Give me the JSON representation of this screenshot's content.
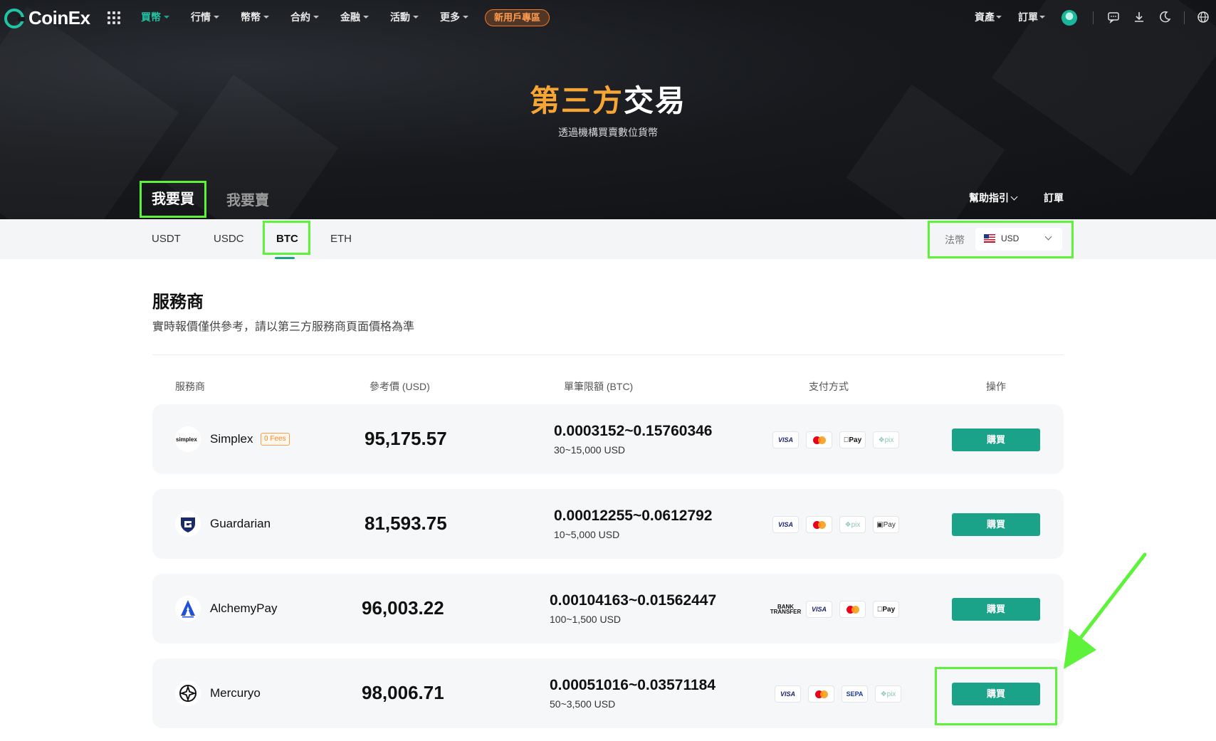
{
  "brand": {
    "name": "CoinEx",
    "accent": "#20c3a4",
    "buy_color": "#1ba389",
    "highlight": "#5ef23a"
  },
  "nav": {
    "menu": [
      "買幣",
      "行情",
      "幣幣",
      "合約",
      "金融",
      "活動",
      "更多"
    ],
    "new_user": "新用戶專區",
    "right": {
      "assets": "資產",
      "orders": "訂單"
    },
    "icons": [
      "grid-menu-icon",
      "avatar",
      "chat-icon",
      "download-icon",
      "moon-icon",
      "globe-icon"
    ]
  },
  "hero": {
    "title_a": "第三方",
    "title_b": "交易",
    "subtitle": "透過機構買賣數位貨幣"
  },
  "tabs": {
    "buy": "我要買",
    "sell": "我要賣",
    "help": "幫助指引",
    "orders": "訂單"
  },
  "coins": [
    "USDT",
    "USDC",
    "BTC",
    "ETH"
  ],
  "selected_coin": "BTC",
  "fiat": {
    "label": "法幣",
    "value": "USD"
  },
  "section": {
    "title": "服務商",
    "subtitle": "實時報價僅供參考，請以第三方服務商頁面價格為準"
  },
  "table": {
    "headers": {
      "provider": "服務商",
      "price": "參考價 (USD)",
      "limit": "單筆限額 (BTC)",
      "payment": "支付方式",
      "action": "操作"
    },
    "rows": [
      {
        "name": "Simplex",
        "badge": "0 Fees",
        "price": "95,175.57",
        "limit": "0.0003152~0.15760346",
        "limit_usd": "30~15,000 USD",
        "payments": [
          "VISA",
          "mastercard",
          "Pay",
          "pix"
        ],
        "action": "購買"
      },
      {
        "name": "Guardarian",
        "price": "81,593.75",
        "limit": "0.00012255~0.0612792",
        "limit_usd": "10~5,000 USD",
        "payments": [
          "VISA",
          "mastercard",
          "pix",
          "Pay"
        ],
        "action": "購買"
      },
      {
        "name": "AlchemyPay",
        "price": "96,003.22",
        "limit": "0.00104163~0.01562447",
        "limit_usd": "100~1,500 USD",
        "payments": [
          "BANK TRANSFER",
          "VISA",
          "mastercard",
          "Pay"
        ],
        "action": "購買"
      },
      {
        "name": "Mercuryo",
        "price": "98,006.71",
        "limit": "0.00051016~0.03571184",
        "limit_usd": "50~3,500 USD",
        "payments": [
          "VISA",
          "mastercard",
          "SEPA",
          "pix"
        ],
        "action": "購買"
      }
    ]
  }
}
